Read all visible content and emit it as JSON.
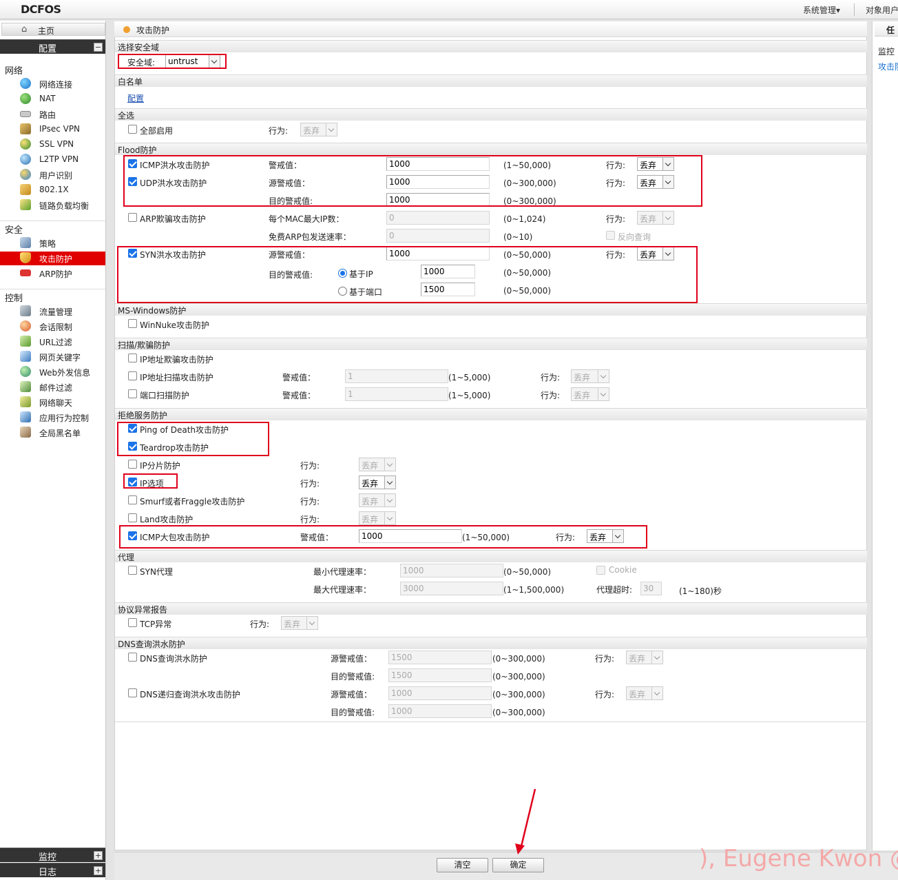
{
  "app": {
    "logo": "DCFOS",
    "top_menu": [
      "系统管理▾",
      "对象用户"
    ]
  },
  "sidebar": {
    "home": "主页",
    "config": "配置",
    "monitor": "监控",
    "log": "日志",
    "toggle_collapse": "−",
    "toggle_expand": "+",
    "groups": {
      "network": "网络",
      "security": "安全",
      "control": "控制"
    },
    "network_items": [
      "网络连接",
      "NAT",
      "路由",
      "IPsec VPN",
      "SSL VPN",
      "L2TP VPN",
      "用户识别",
      "802.1X",
      "链路负载均衡"
    ],
    "security_items": [
      "策略",
      "攻击防护",
      "ARP防护"
    ],
    "control_items": [
      "流量管理",
      "会话限制",
      "URL过滤",
      "网页关键字",
      "Web外发信息",
      "邮件过滤",
      "网络聊天",
      "应用行为控制",
      "全局黑名单"
    ]
  },
  "right_panel": {
    "tab": "任",
    "monitor": "监控",
    "link": "攻击防"
  },
  "page": {
    "title": "攻击防护",
    "sections": {
      "zone": "选择安全域",
      "whitelist": "白名单",
      "select_all": "全选",
      "flood": "Flood防护",
      "mswindows": "MS-Windows防护",
      "scan": "扫描/欺骗防护",
      "dos": "拒绝服务防护",
      "proxy": "代理",
      "protocol": "协议异常报告",
      "dns": "DNS查询洪水防护"
    },
    "zone_label": "安全域:",
    "zone_value": "untrust",
    "whitelist_link": "配置",
    "action_label": "行为:",
    "action_drop": "丢弃",
    "select_all_label": "全部启用",
    "flood": {
      "icmp": {
        "label": "ICMP洪水攻击防护",
        "threshold_label": "警戒值：",
        "value": "1000",
        "range": "(1~50,000)"
      },
      "udp": {
        "label": "UDP洪水攻击防护",
        "src_label": "源警戒值：",
        "src_value": "1000",
        "src_range": "(0~300,000)",
        "dst_label": "目的警戒值:",
        "dst_value": "1000",
        "dst_range": "(0~300,000)"
      },
      "arp": {
        "label": "ARP欺骗攻击防护",
        "mac_label": "每个MAC最大IP数：",
        "mac_value": "0",
        "mac_range": "(0~1,024)",
        "rate_label": "免费ARP包发送速率：",
        "rate_value": "0",
        "rate_range": "(0~10)",
        "reverse_label": "反向查询"
      },
      "syn": {
        "label": "SYN洪水攻击防护",
        "src_label": "源警戒值：",
        "src_value": "1000",
        "src_range": "(0~50,000)",
        "dst_label": "目的警戒值:",
        "by_ip": "基于IP",
        "by_ip_value": "1000",
        "by_ip_range": "(0~50,000)",
        "by_port": "基于端口",
        "by_port_value": "1500",
        "by_port_range": "(0~50,000)"
      }
    },
    "winnuke": "WinNuke攻击防护",
    "scan": {
      "ip_spoof": "IP地址欺骗攻击防护",
      "ip_scan": "IP地址扫描攻击防护",
      "port_scan": "端口扫描防护",
      "threshold_label": "警戒值：",
      "ip_scan_value": "1",
      "port_scan_value": "1",
      "range": "(1~5,000)"
    },
    "dos": {
      "ping_of_death": "Ping of Death攻击防护",
      "teardrop": "Teardrop攻击防护",
      "ip_frag": "IP分片防护",
      "ip_option": "IP选项",
      "smurf": "Smurf或者Fraggle攻击防护",
      "land": "Land攻击防护",
      "icmp_large": "ICMP大包攻击防护",
      "icmp_large_threshold_label": "警戒值：",
      "icmp_large_value": "1000",
      "icmp_large_range": "(1~50,000)"
    },
    "proxy": {
      "syn_proxy": "SYN代理",
      "min_rate_label": "最小代理速率：",
      "min_rate_value": "1000",
      "min_rate_range": "(0~50,000)",
      "max_rate_label": "最大代理速率：",
      "max_rate_value": "3000",
      "max_rate_range": "(1~1,500,000)",
      "cookie_label": "Cookie",
      "timeout_label": "代理超时:",
      "timeout_value": "30",
      "timeout_range": "(1~180)秒"
    },
    "protocol": {
      "tcp": "TCP异常"
    },
    "dns": {
      "query_flood": "DNS查询洪水防护",
      "recursive_flood": "DNS递归查询洪水攻击防护",
      "src_label": "源警戒值：",
      "dst_label": "目的警戒值:",
      "q_src_value": "1500",
      "q_dst_value": "1500",
      "r_src_value": "1000",
      "r_dst_value": "1000",
      "range": "(0~300,000)"
    },
    "buttons": {
      "clear": "清空",
      "ok": "确定"
    }
  },
  "watermark": "), Eugene Kwon @"
}
